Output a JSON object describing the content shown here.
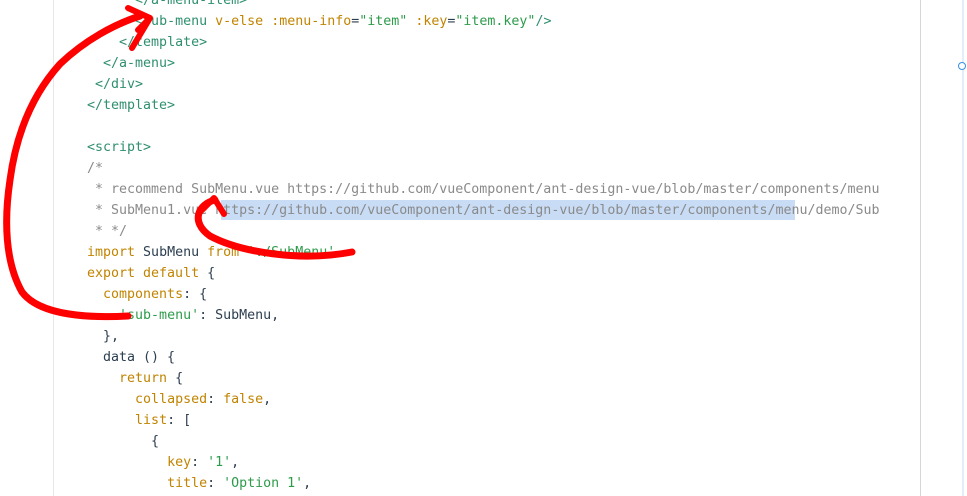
{
  "colors": {
    "tag": "#2f8f6f",
    "attr": "#c18401",
    "string": "#2e9b4b",
    "comment": "#8a8a8a",
    "keyword": "#c18401",
    "property": "#c18401",
    "plain": "#2c3e50",
    "selection": "#c9dcf5",
    "annotation": "#ff0000"
  },
  "lines": [
    {
      "indent": "      ",
      "tokens": [
        {
          "t": "tag",
          "v": "</a-menu-item>"
        }
      ]
    },
    {
      "indent": "      ",
      "tokens": [
        {
          "t": "tag",
          "v": "<sub-menu"
        },
        {
          "t": "plain",
          "v": " "
        },
        {
          "t": "attr",
          "v": "v-else"
        },
        {
          "t": "plain",
          "v": " "
        },
        {
          "t": "attr",
          "v": ":menu-info"
        },
        {
          "t": "plain",
          "v": "="
        },
        {
          "t": "string",
          "v": "\"item\""
        },
        {
          "t": "plain",
          "v": " "
        },
        {
          "t": "attr",
          "v": ":key"
        },
        {
          "t": "plain",
          "v": "="
        },
        {
          "t": "string",
          "v": "\"item.key\""
        },
        {
          "t": "tag",
          "v": "/>"
        }
      ]
    },
    {
      "indent": "    ",
      "tokens": [
        {
          "t": "tag",
          "v": "</template>"
        }
      ]
    },
    {
      "indent": "  ",
      "tokens": [
        {
          "t": "tag",
          "v": "</a-menu>"
        }
      ]
    },
    {
      "indent": " ",
      "tokens": [
        {
          "t": "tag",
          "v": "</div>"
        }
      ]
    },
    {
      "indent": "",
      "tokens": [
        {
          "t": "tag",
          "v": "</template>"
        }
      ]
    },
    {
      "indent": "",
      "tokens": []
    },
    {
      "indent": "",
      "tokens": [
        {
          "t": "tag",
          "v": "<script>"
        }
      ]
    },
    {
      "indent": "",
      "tokens": [
        {
          "t": "comment",
          "v": "/*"
        }
      ]
    },
    {
      "indent": "",
      "tokens": [
        {
          "t": "comment",
          "v": " * recommend SubMenu.vue https://github.com/vueComponent/ant-design-vue/blob/master/components/menu"
        }
      ]
    },
    {
      "indent": "",
      "tokens": [
        {
          "t": "comment",
          "v": " * SubMenu1.vue https://github.com/vueComponent/ant-design-vue/blob/master/components/menu/demo/Sub"
        }
      ]
    },
    {
      "indent": "",
      "tokens": [
        {
          "t": "comment",
          "v": " * */"
        }
      ]
    },
    {
      "indent": "",
      "tokens": [
        {
          "t": "keyword",
          "v": "import"
        },
        {
          "t": "plain",
          "v": " SubMenu "
        },
        {
          "t": "keyword",
          "v": "from"
        },
        {
          "t": "plain",
          "v": " "
        },
        {
          "t": "string",
          "v": "'./SubMenu'"
        }
      ]
    },
    {
      "indent": "",
      "tokens": [
        {
          "t": "keyword",
          "v": "export default"
        },
        {
          "t": "plain",
          "v": " {"
        }
      ]
    },
    {
      "indent": "  ",
      "tokens": [
        {
          "t": "property",
          "v": "components"
        },
        {
          "t": "plain",
          "v": ": {"
        }
      ]
    },
    {
      "indent": "    ",
      "tokens": [
        {
          "t": "string",
          "v": "'sub-menu'"
        },
        {
          "t": "plain",
          "v": ": SubMenu,"
        }
      ]
    },
    {
      "indent": "  ",
      "tokens": [
        {
          "t": "plain",
          "v": "},"
        }
      ]
    },
    {
      "indent": "  ",
      "tokens": [
        {
          "t": "plain",
          "v": "data () {"
        }
      ]
    },
    {
      "indent": "    ",
      "tokens": [
        {
          "t": "keyword",
          "v": "return"
        },
        {
          "t": "plain",
          "v": " {"
        }
      ]
    },
    {
      "indent": "      ",
      "tokens": [
        {
          "t": "property",
          "v": "collapsed"
        },
        {
          "t": "plain",
          "v": ": "
        },
        {
          "t": "keyword",
          "v": "false"
        },
        {
          "t": "plain",
          "v": ","
        }
      ]
    },
    {
      "indent": "      ",
      "tokens": [
        {
          "t": "property",
          "v": "list"
        },
        {
          "t": "plain",
          "v": ": ["
        }
      ]
    },
    {
      "indent": "        ",
      "tokens": [
        {
          "t": "plain",
          "v": "{"
        }
      ]
    },
    {
      "indent": "          ",
      "tokens": [
        {
          "t": "property",
          "v": "key"
        },
        {
          "t": "plain",
          "v": ": "
        },
        {
          "t": "string",
          "v": "'1'"
        },
        {
          "t": "plain",
          "v": ","
        }
      ]
    },
    {
      "indent": "          ",
      "tokens": [
        {
          "t": "property",
          "v": "title"
        },
        {
          "t": "plain",
          "v": ": "
        },
        {
          "t": "string",
          "v": "'Option 1'"
        },
        {
          "t": "plain",
          "v": ","
        }
      ]
    }
  ]
}
